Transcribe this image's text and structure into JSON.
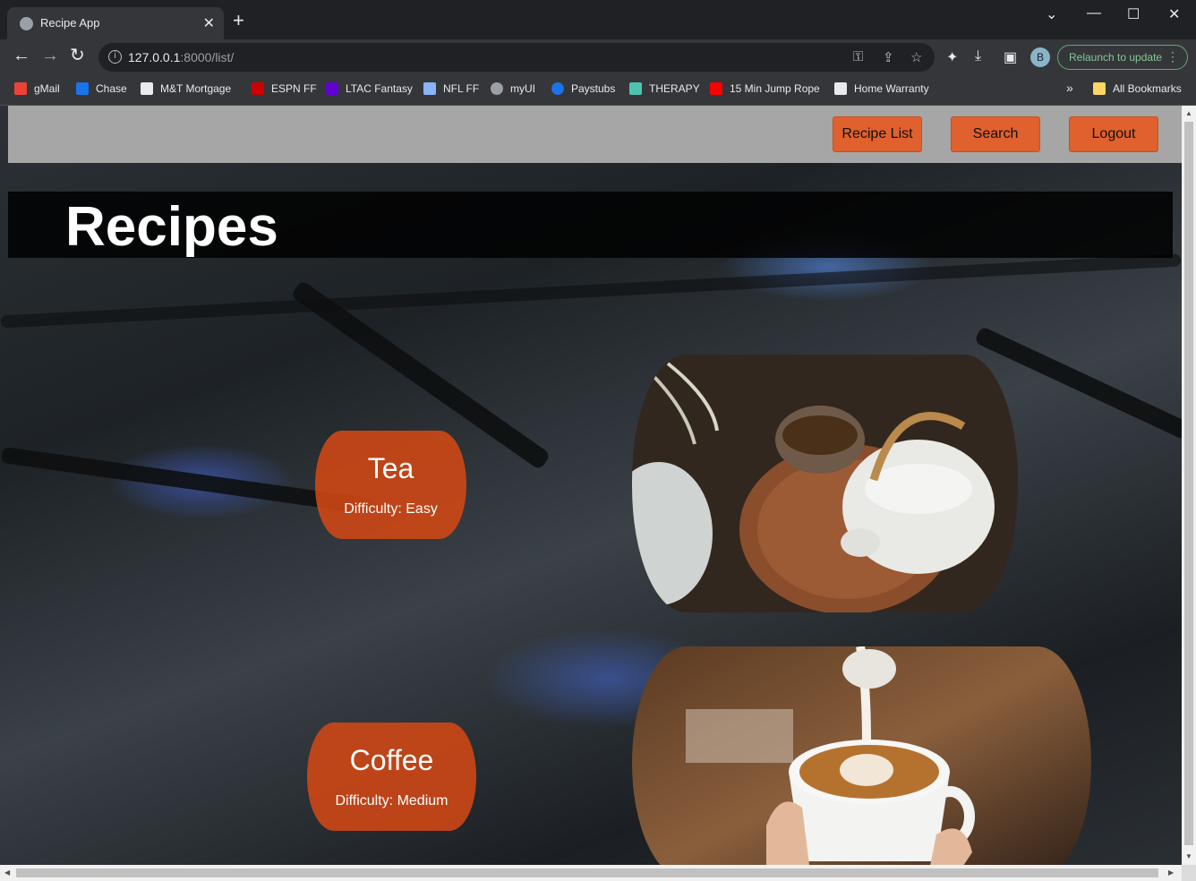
{
  "browser": {
    "tab_title": "Recipe App",
    "url_host": "127.0.0.1",
    "url_rest": ":8000/list/",
    "profile_initial": "B",
    "relaunch_label": "Relaunch to update",
    "new_tab": "+",
    "tab_close": "✕",
    "bookmarks": [
      {
        "label": "gMail",
        "color": "#ea4335"
      },
      {
        "label": "Chase",
        "color": "#1a73e8"
      },
      {
        "label": "M&T Mortgage",
        "color": "#e8eaed"
      },
      {
        "label": "ESPN FF",
        "color": "#cc0000"
      },
      {
        "label": "LTAC Fantasy",
        "color": "#6001d2"
      },
      {
        "label": "NFL FF",
        "color": "#8ab4f8"
      },
      {
        "label": "myUI",
        "color": "#9aa0a6"
      },
      {
        "label": "Paystubs",
        "color": "#1a73e8"
      },
      {
        "label": "THERAPY",
        "color": "#4fc3b0"
      },
      {
        "label": "15 Min Jump Rope",
        "color": "#ff0000"
      },
      {
        "label": "Home Warranty",
        "color": "#e8eaed"
      }
    ],
    "more_bookmarks": "»",
    "all_bookmarks": "All Bookmarks"
  },
  "app": {
    "nav": {
      "recipe_list": "Recipe List",
      "search": "Search",
      "logout": "Logout"
    },
    "heading": "Recipes",
    "recipes": [
      {
        "name": "Tea",
        "difficulty": "Difficulty: Easy"
      },
      {
        "name": "Coffee",
        "difficulty": "Difficulty: Medium"
      }
    ]
  },
  "colors": {
    "accent": "#e0602e",
    "navbar": "#a6a6a6",
    "card": "#d24814"
  }
}
